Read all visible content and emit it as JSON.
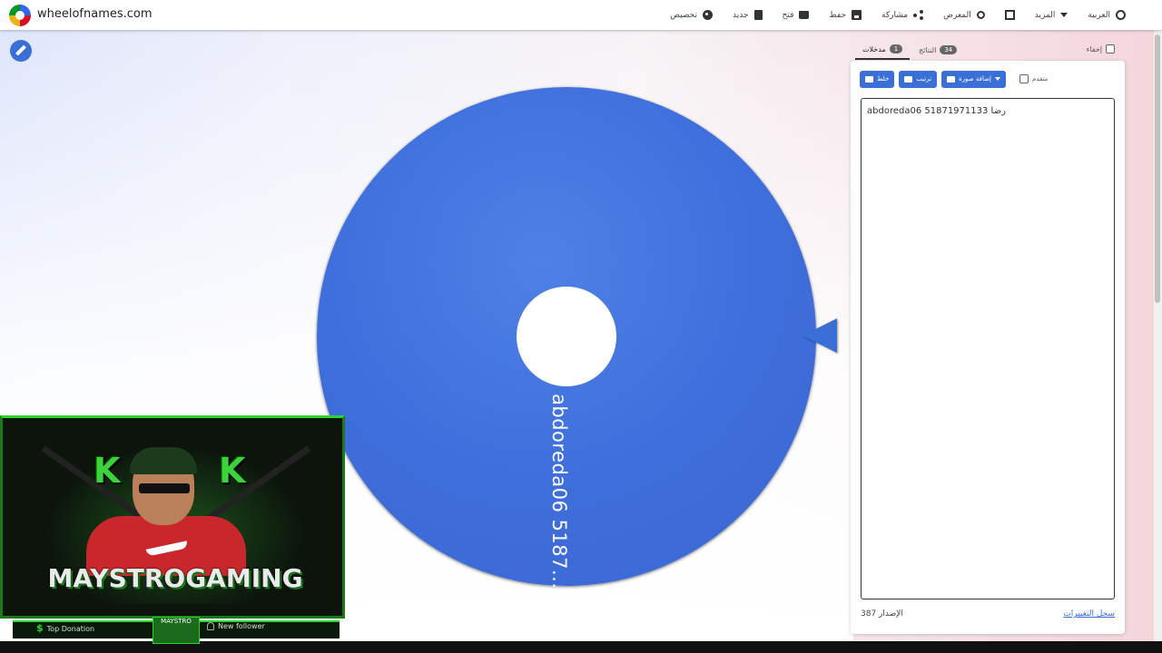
{
  "app": {
    "site": "wheelofnames.com"
  },
  "header": {
    "nav": [
      {
        "label": "العربية",
        "icon": "globe-icon"
      },
      {
        "label": "المزيد",
        "icon": "caret-down-icon"
      },
      {
        "label": "",
        "icon": "fullscreen-icon"
      },
      {
        "label": "المعرض",
        "icon": "search-icon"
      },
      {
        "label": "مشاركة",
        "icon": "share-icon"
      },
      {
        "label": "حفظ",
        "icon": "save-icon"
      },
      {
        "label": "فتح",
        "icon": "folder-icon"
      },
      {
        "label": "جديد",
        "icon": "file-icon"
      },
      {
        "label": "تخصيص",
        "icon": "palette-icon"
      }
    ]
  },
  "panel": {
    "hide_label": "إخفاء",
    "tabs": [
      {
        "label": "مدخلات",
        "count": "1"
      },
      {
        "label": "النتائج",
        "count": "34"
      }
    ],
    "toolbar": {
      "shuffle": "خلط",
      "sort": "ترتيب",
      "add_image": "إضافة صورة",
      "advanced": "متقدم"
    },
    "entries_text": "abdoreda06 51871971133 رضا",
    "version": "الإصدار 387",
    "changelog": "سجل التغييرات"
  },
  "wheel": {
    "segment_label": "abdoreda06  5187...",
    "color": "#3f6fdc"
  },
  "overlay": {
    "letters": [
      "K",
      "K"
    ],
    "name": "MAYSTROGAMING",
    "donation": "Top Donation",
    "follower": "New follower",
    "mini": "MAYSTRO"
  },
  "colors": {
    "accent": "#3a6fd8"
  }
}
